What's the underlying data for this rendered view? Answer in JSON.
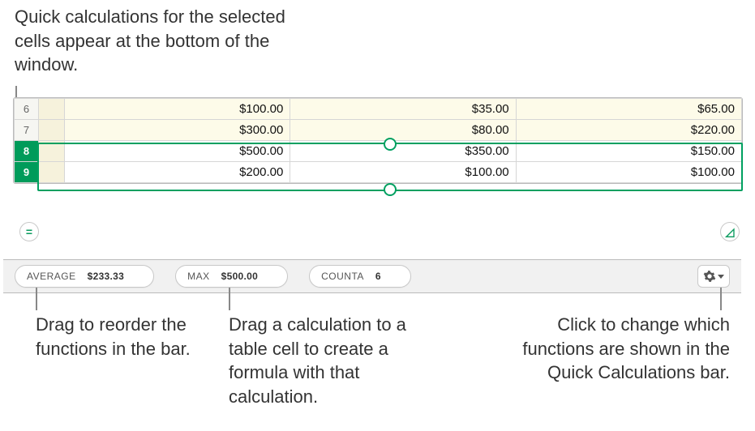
{
  "callouts": {
    "top": "Quick calculations for the selected cells appear at the bottom of the window.",
    "bottom_left": "Drag to reorder the functions in the bar.",
    "bottom_mid": "Drag a calculation to a table cell to create a formula with that calculation.",
    "bottom_right": "Click to change which functions are shown in the Quick Calculations bar."
  },
  "table": {
    "rows": [
      {
        "num": "6",
        "stub": "",
        "selected": false,
        "cells": [
          "$100.00",
          "$35.00",
          "$65.00"
        ]
      },
      {
        "num": "7",
        "stub": "",
        "selected": false,
        "cells": [
          "$300.00",
          "$80.00",
          "$220.00"
        ]
      },
      {
        "num": "8",
        "stub": "",
        "selected": true,
        "cells": [
          "$500.00",
          "$350.00",
          "$150.00"
        ]
      },
      {
        "num": "9",
        "stub": "",
        "selected": true,
        "cells": [
          "$200.00",
          "$100.00",
          "$100.00"
        ]
      }
    ]
  },
  "calc": {
    "items": [
      {
        "fn": "AVERAGE",
        "val": "$233.33"
      },
      {
        "fn": "MAX",
        "val": "$500.00"
      },
      {
        "fn": "COUNTA",
        "val": "6"
      }
    ]
  }
}
